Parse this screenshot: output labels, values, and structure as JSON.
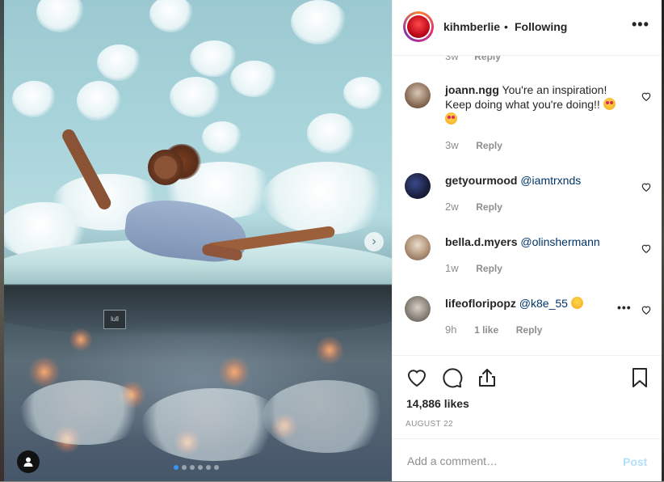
{
  "post": {
    "author": "kihmberlie",
    "separator": "•",
    "follow_status": "Following",
    "more_label": "•••",
    "photo_tag_label": "lull",
    "carousel": {
      "total": 6,
      "active_index": 0
    }
  },
  "partial_comment": {
    "time": "3w",
    "reply": "Reply"
  },
  "comments": [
    {
      "user": "joann.ngg",
      "text": " You're an inspiration! Keep doing what you're doing!! ",
      "mention": "",
      "emojis": [
        "heart-eyes",
        "heart-eyes"
      ],
      "time": "3w",
      "likes": "",
      "reply": "Reply"
    },
    {
      "user": "getyourmood",
      "text": " ",
      "mention": "@iamtrxnds",
      "emojis": [],
      "time": "2w",
      "likes": "",
      "reply": "Reply"
    },
    {
      "user": "bella.d.myers",
      "text": " ",
      "mention": "@olinshermann",
      "emojis": [],
      "time": "1w",
      "likes": "",
      "reply": "Reply"
    },
    {
      "user": "lifeofloripopz",
      "text": " ",
      "mention": "@k8e_55",
      "emojis": [
        "mind-blown"
      ],
      "time": "9h",
      "likes": "1 like",
      "reply": "Reply",
      "more": "•••"
    }
  ],
  "likes_label": "14,886 likes",
  "date_label": "AUGUST 22",
  "add_comment": {
    "placeholder": "Add a comment…",
    "post_label": "Post"
  },
  "colors": {
    "accent": "#3897f0",
    "post_disabled": "#b2dffc",
    "mention": "#003569",
    "meta": "#8e8e8e"
  }
}
